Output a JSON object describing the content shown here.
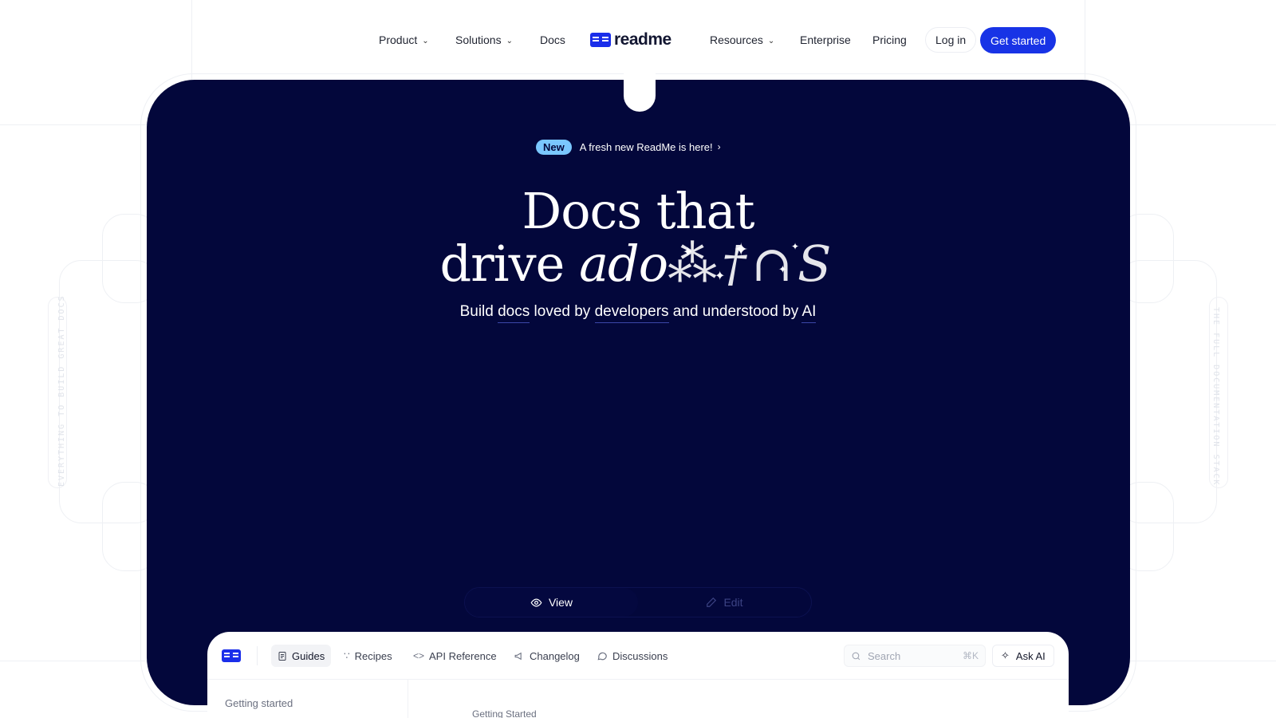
{
  "nav": {
    "items_left": [
      {
        "label": "Product",
        "has_dropdown": true
      },
      {
        "label": "Solutions",
        "has_dropdown": true
      },
      {
        "label": "Docs",
        "has_dropdown": false
      }
    ],
    "logo_text": "readme",
    "items_right": [
      {
        "label": "Resources",
        "has_dropdown": true
      },
      {
        "label": "Enterprise",
        "has_dropdown": false
      },
      {
        "label": "Pricing",
        "has_dropdown": false
      }
    ],
    "login_label": "Log in",
    "cta_label": "Get started"
  },
  "announcement": {
    "badge": "New",
    "text": "A fresh new ReadMe is here!",
    "arrow": "›"
  },
  "hero": {
    "headline_line1": "Docs that",
    "headline_line2_plain": "drive ",
    "headline_line2_emphasis": "adoption",
    "headline_line2_emphasis_visible": "ado",
    "subheadline_parts": [
      "Build ",
      "docs",
      " loved by ",
      "developers",
      " and understood by ",
      "AI"
    ]
  },
  "mode_toggle": {
    "view_label": "View",
    "edit_label": "Edit",
    "selected": "View"
  },
  "docs_preview": {
    "tabs": [
      {
        "label": "Guides",
        "icon": "document-icon",
        "active": true
      },
      {
        "label": "Recipes",
        "icon": "recipes-icon",
        "active": false
      },
      {
        "label": "API Reference",
        "icon": "code-icon",
        "active": false
      },
      {
        "label": "Changelog",
        "icon": "megaphone-icon",
        "active": false
      },
      {
        "label": "Discussions",
        "icon": "chat-icon",
        "active": false
      }
    ],
    "search_placeholder": "Search",
    "search_shortcut": "⌘K",
    "ask_ai_label": "Ask AI",
    "sidebar_heading": "Getting started",
    "main_heading": "Getting Started"
  },
  "side_labels": {
    "left": "EVERYTHING TO BUILD GREAT DOCS",
    "right": "THE FULL DOCUMENTATION STACK"
  },
  "colors": {
    "hero_background": "#03073b",
    "accent_blue": "#1833e6",
    "badge_blue": "#7ac7ff"
  }
}
